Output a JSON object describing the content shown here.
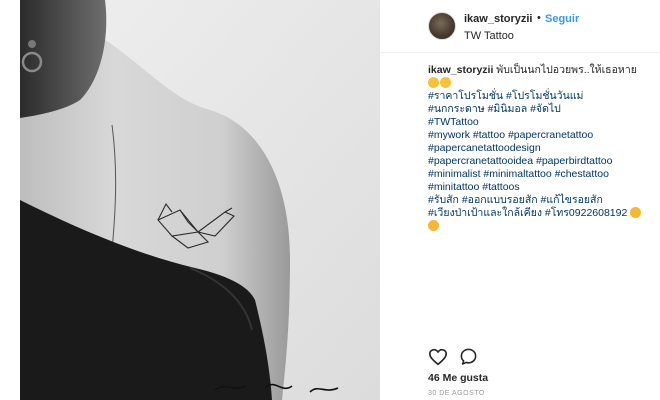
{
  "post": {
    "username": "ikaw_storyzii",
    "separator": "•",
    "follow_label": "Seguir",
    "location": "TW Tattoo"
  },
  "caption": {
    "username": "ikaw_storyzii",
    "text": "พับเป็นนกไปอวยพร..ให้เธอหาย",
    "hashtags": [
      "#ราคาโปรโมชั่น #โปรโมชั่นวันแม่",
      "#นกกระดาษ #มินิมอล #จัดไป",
      "#TWTattoo",
      "#mywork #tattoo #papercranetattoo",
      "#papercanetattoodesign",
      "#papercranetattooidea #paperbirdtattoo",
      "#minimalist #minimaltattoo #chestattoo",
      "#minitattoo #tattoos",
      "#รับสัก #ออกแบบรอยสัก #แก้ไขรอยสัก",
      "#เวียงป่าเป้าและใกล้เคียง #โทร0922608192"
    ]
  },
  "engagement": {
    "likes": "46 Me gusta",
    "date": "30 DE AGOSTO"
  },
  "icons": {
    "like": "heart-outline-icon",
    "comment": "speech-bubble-icon"
  },
  "colors": {
    "link": "#003569",
    "follow": "#3897f0",
    "text": "#262626",
    "muted": "#999999"
  }
}
